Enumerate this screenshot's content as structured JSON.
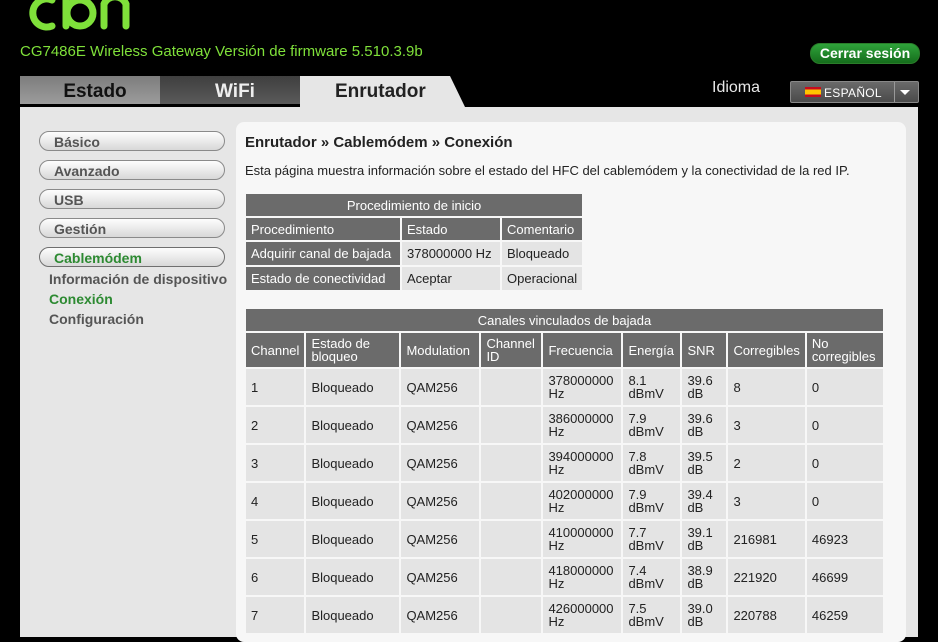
{
  "brand": {
    "logo_alt": "cbn",
    "model_line": "CG7486E Wireless Gateway   Versión de firmware 5.510.3.9b"
  },
  "header": {
    "logout_label": "Cerrar sesión",
    "language_label": "Idioma",
    "language_value": "ESPAÑOL"
  },
  "tabs": [
    {
      "label": "Estado",
      "active": false
    },
    {
      "label": "WiFi",
      "active": false
    },
    {
      "label": "Enrutador",
      "active": true
    }
  ],
  "sidebar": {
    "items": [
      {
        "label": "Básico"
      },
      {
        "label": "Avanzado"
      },
      {
        "label": "USB"
      },
      {
        "label": "Gestión"
      },
      {
        "label": "Cablemódem",
        "active": true
      }
    ],
    "subitems": [
      {
        "label": "Información de dispositivo"
      },
      {
        "label": "Conexión",
        "active": true
      },
      {
        "label": "Configuración"
      }
    ]
  },
  "main": {
    "breadcrumb": "Enrutador » Cablemódem » Conexión",
    "description": "Esta página muestra información sobre el estado del HFC del cablemódem y la conectividad de la red IP.",
    "startup": {
      "title": "Procedimiento de inicio",
      "headers": [
        "Procedimiento",
        "Estado",
        "Comentario"
      ],
      "rows": [
        [
          "Adquirir canal de bajada",
          "378000000 Hz",
          "Bloqueado"
        ],
        [
          "Estado de conectividad",
          "Aceptar",
          "Operacional"
        ]
      ]
    },
    "downstream": {
      "title": "Canales vinculados de bajada",
      "headers": [
        "Channel",
        "Estado de bloqueo",
        "Modulation",
        "Channel ID",
        "Frecuencia",
        "Energía",
        "SNR",
        "Corregibles",
        "No corregibles"
      ],
      "rows": [
        [
          "1",
          "Bloqueado",
          "QAM256",
          "",
          "378000000 Hz",
          "8.1 dBmV",
          "39.6 dB",
          "8",
          "0"
        ],
        [
          "2",
          "Bloqueado",
          "QAM256",
          "",
          "386000000 Hz",
          "7.9 dBmV",
          "39.6 dB",
          "3",
          "0"
        ],
        [
          "3",
          "Bloqueado",
          "QAM256",
          "",
          "394000000 Hz",
          "7.8 dBmV",
          "39.5 dB",
          "2",
          "0"
        ],
        [
          "4",
          "Bloqueado",
          "QAM256",
          "",
          "402000000 Hz",
          "7.9 dBmV",
          "39.4 dB",
          "3",
          "0"
        ],
        [
          "5",
          "Bloqueado",
          "QAM256",
          "",
          "410000000 Hz",
          "7.7 dBmV",
          "39.1 dB",
          "216981",
          "46923"
        ],
        [
          "6",
          "Bloqueado",
          "QAM256",
          "",
          "418000000 Hz",
          "7.4 dBmV",
          "38.9 dB",
          "221920",
          "46699"
        ],
        [
          "7",
          "Bloqueado",
          "QAM256",
          "",
          "426000000 Hz",
          "7.5 dBmV",
          "39.0 dB",
          "220788",
          "46259"
        ]
      ]
    }
  }
}
